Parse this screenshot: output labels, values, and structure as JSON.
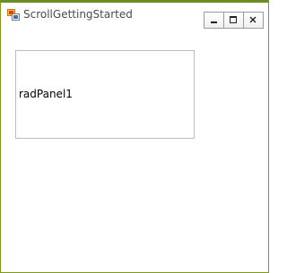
{
  "window": {
    "title": "ScrollGettingStarted",
    "icon": "winforms-app-icon",
    "controls": {
      "minimize_icon": "minimize-icon",
      "maximize_icon": "maximize-icon",
      "close_icon": "close-icon"
    },
    "frame_color": "#6b8e23"
  },
  "panel": {
    "label": "radPanel1",
    "border_color": "#bdbdbd"
  }
}
